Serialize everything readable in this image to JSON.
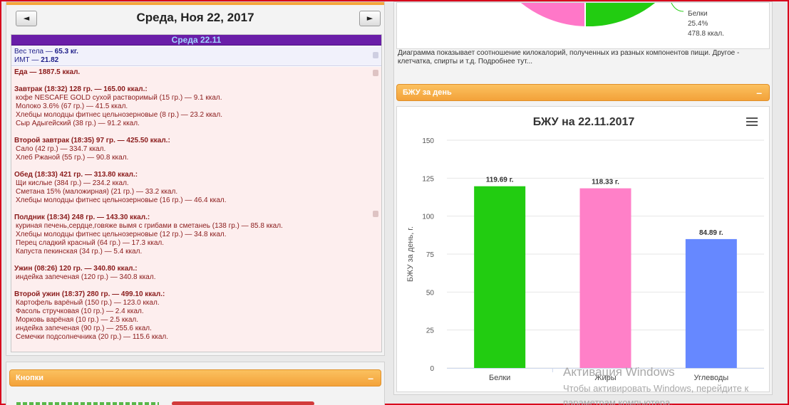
{
  "nav": {
    "prev": "◄",
    "next": "►",
    "date": "Среда, Ноя 22, 2017"
  },
  "day": {
    "header": "Среда 22.11",
    "weight_label": "Вес тела — ",
    "weight_value": "65.3 кг.",
    "bmi_label": "ИМТ — ",
    "bmi_value": "21.82",
    "lines": [
      {
        "t": "Еда — 1887.5 ккал.",
        "k": "meal"
      },
      {
        "t": "",
        "k": "gap"
      },
      {
        "t": "Завтрак (18:32) 128 гр. — 165.00 ккал.:",
        "k": "meal"
      },
      {
        "t": "кофе NESCAFE GOLD сухой растворимый (15 гр.) — 9.1 ккал.",
        "k": "item"
      },
      {
        "t": "Молоко 3.6% (67 гр.) — 41.5 ккал.",
        "k": "item"
      },
      {
        "t": "Хлебцы молодцы фитнес цельнозерновые (8 гр.) — 23.2 ккал.",
        "k": "item"
      },
      {
        "t": "Сыр Адыгейский (38 гр.) — 91.2 ккал.",
        "k": "item"
      },
      {
        "t": "",
        "k": "gap"
      },
      {
        "t": "Второй завтрак (18:35) 97 гр. — 425.50 ккал.:",
        "k": "meal"
      },
      {
        "t": "Сало (42 гр.) — 334.7 ккал.",
        "k": "item"
      },
      {
        "t": "Хлеб Ржаной (55 гр.) — 90.8 ккал.",
        "k": "item"
      },
      {
        "t": "",
        "k": "gap"
      },
      {
        "t": "Обед (18:33) 421 гр. — 313.80 ккал.:",
        "k": "meal"
      },
      {
        "t": "Щи кислые (384 гр.) — 234.2 ккал.",
        "k": "item"
      },
      {
        "t": "Сметана 15% (маложирная) (21 гр.) — 33.2 ккал.",
        "k": "item"
      },
      {
        "t": "Хлебцы молодцы фитнес цельнозерновые (16 гр.) — 46.4 ккал.",
        "k": "item"
      },
      {
        "t": "",
        "k": "gap"
      },
      {
        "t": "Полдник (18:34) 248 гр. — 143.30 ккал.:",
        "k": "meal"
      },
      {
        "t": "куриная печень,сердце,говяже вымя с грибами в сметанеь (138 гр.) — 85.8 ккал.",
        "k": "item"
      },
      {
        "t": "Хлебцы молодцы фитнес цельнозерновые (12 гр.) — 34.8 ккал.",
        "k": "item"
      },
      {
        "t": "Перец сладкий красный (64 гр.) — 17.3 ккал.",
        "k": "item"
      },
      {
        "t": "Капуста пекинская (34 гр.) — 5.4 ккал.",
        "k": "item"
      },
      {
        "t": "",
        "k": "gap"
      },
      {
        "t": "Ужин (08:26) 120 гр. — 340.80 ккал.:",
        "k": "meal"
      },
      {
        "t": "индейка запеченая (120 гр.) — 340.8 ккал.",
        "k": "item"
      },
      {
        "t": "",
        "k": "gap"
      },
      {
        "t": "Второй ужин (18:37) 280 гр. — 499.10 ккал.:",
        "k": "meal"
      },
      {
        "t": "Картофель варёный (150 гр.) — 123.0 ккал.",
        "k": "item"
      },
      {
        "t": "Фасоль стручковая (10 гр.) — 2.4 ккал.",
        "k": "item"
      },
      {
        "t": "Морковь варёная (10 гр.) — 2.5 ккал.",
        "k": "item"
      },
      {
        "t": "индейка запеченая (90 гр.) — 255.6 ккал.",
        "k": "item"
      },
      {
        "t": "Семечки подсолнечника (20 гр.) — 115.6 ккал.",
        "k": "item"
      }
    ]
  },
  "buttons_widget": {
    "title": "Кнопки",
    "minimize": "–"
  },
  "pie": {
    "legend_name": "Белки",
    "legend_pct": "25.4%",
    "legend_kcal": "478.8 ккал.",
    "colors": {
      "pink": "#ff77c8",
      "green": "#22cc11"
    },
    "note": "Диаграмма показывает соотношение килокалорий, полученных из разных компонентов пищи. Другое - клетчатка, спирты и т.д. Подробнее тут..."
  },
  "bju_widget": {
    "title": "БЖУ за день",
    "minimize": "–"
  },
  "chart_data": {
    "type": "bar",
    "title": "БЖУ на 22.11.2017",
    "ylabel": "БЖУ за день, г.",
    "xlabel": "",
    "categories": [
      "Белки",
      "Жиры",
      "Углеводы"
    ],
    "values": [
      119.69,
      118.33,
      84.89
    ],
    "data_labels": [
      "119.69 г.",
      "118.33 г.",
      "84.89 г."
    ],
    "colors": [
      "#22cc11",
      "#ff80c8",
      "#6688ff"
    ],
    "ylim": [
      0,
      150
    ],
    "yticks": [
      0,
      25,
      50,
      75,
      100,
      125,
      150
    ],
    "grid": true
  },
  "watermark": {
    "line1": "Активация Windows",
    "line2": "Чтобы активировать Windows, перейдите к",
    "line3": "параметрам компьютера."
  }
}
